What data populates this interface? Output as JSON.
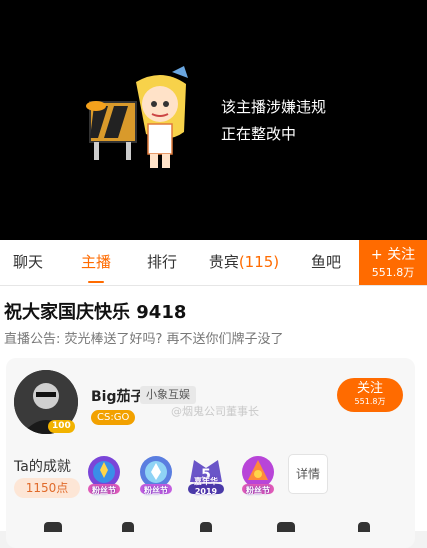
{
  "video": {
    "notice_line1": "该主播涉嫌违规",
    "notice_line2": "正在整改中"
  },
  "tabs": [
    {
      "label": "聊天"
    },
    {
      "label": "主播"
    },
    {
      "label": "排行"
    },
    {
      "label": "贵宾",
      "count": "(115)"
    },
    {
      "label": "鱼吧"
    }
  ],
  "follow_tab": {
    "label": "+ 关注",
    "count": "551.8万"
  },
  "room": {
    "title": "祝大家国庆快乐 9418",
    "announcement": "直播公告: 荧光棒送了好吗? 再不送你们牌子没了"
  },
  "anchor": {
    "name": "Big茄子",
    "guild": "小象互娱",
    "game_tag": "CS:GO",
    "level_badge": "100",
    "watermark": "@烟鬼公司董事长",
    "follow_label": "关注",
    "follow_count": "551.8万"
  },
  "achievements": {
    "label": "Ta的成就",
    "points": "1150点",
    "badges": [
      {
        "text": "粉丝节"
      },
      {
        "text": "粉丝节"
      },
      {
        "text": "嘉年华2019"
      },
      {
        "text": "粉丝节"
      }
    ],
    "detail_label": "详情"
  },
  "colors": {
    "accent": "#ff6b00",
    "video_bg": "#000000"
  }
}
